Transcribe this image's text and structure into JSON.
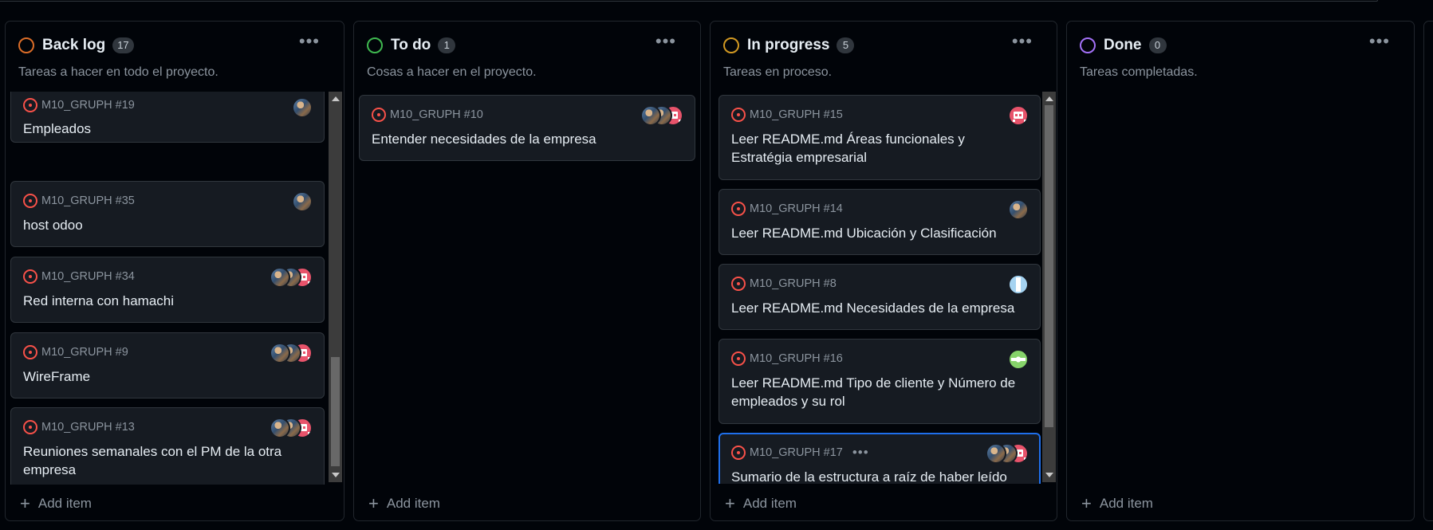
{
  "board": {
    "columns": [
      {
        "title": "Back log",
        "count": "17",
        "description": "Tareas a hacer en todo el proyecto.",
        "status_color": "#db6d28",
        "add_item": "Add item",
        "cards": [
          {
            "ref": "M10_GRUPH #19",
            "title": "Empleados",
            "avatars": [
              "photo"
            ]
          },
          {
            "ref": "M10_GRUPH #35",
            "title": "host odoo",
            "avatars": [
              "photo"
            ]
          },
          {
            "ref": "M10_GRUPH #34",
            "title": "Red interna con hamachi",
            "avatars": [
              "photo",
              "photo",
              "pink"
            ]
          },
          {
            "ref": "M10_GRUPH #9",
            "title": "WireFrame",
            "avatars": [
              "photo",
              "photo",
              "pink"
            ]
          },
          {
            "ref": "M10_GRUPH #13",
            "title": "Reuniones semanales con el PM de la otra empresa",
            "avatars": [
              "photo",
              "photo",
              "pink"
            ]
          }
        ]
      },
      {
        "title": "To do",
        "count": "1",
        "description": "Cosas a hacer en el proyecto.",
        "status_color": "#3fb950",
        "add_item": "Add item",
        "cards": [
          {
            "ref": "M10_GRUPH #10",
            "title": "Entender necesidades de la empresa",
            "avatars": [
              "photo",
              "photo",
              "pink"
            ]
          }
        ]
      },
      {
        "title": "In progress",
        "count": "5",
        "description": "Tareas en proceso.",
        "status_color": "#d29922",
        "add_item": "Add item",
        "cards": [
          {
            "ref": "M10_GRUPH #15",
            "title": "Leer README.md Áreas funcionales y Estratégia empresarial",
            "avatars": [
              "pink"
            ]
          },
          {
            "ref": "M10_GRUPH #14",
            "title": "Leer README.md Ubicación y Clasificación",
            "avatars": [
              "photo"
            ]
          },
          {
            "ref": "M10_GRUPH #8",
            "title": "Leer README.md Necesidades de la empresa",
            "avatars": [
              "blue"
            ]
          },
          {
            "ref": "M10_GRUPH #16",
            "title": "Leer README.md Tipo de cliente y Número de empleados y su rol",
            "avatars": [
              "green"
            ]
          },
          {
            "ref": "M10_GRUPH #17",
            "title": "Sumario de la estructura a raíz de haber leído",
            "avatars": [
              "photo",
              "photo",
              "pink"
            ],
            "selected": true,
            "menu": "•••"
          }
        ]
      },
      {
        "title": "Done",
        "count": "0",
        "description": "Tareas completadas.",
        "status_color": "#a371f7",
        "add_item": "Add item",
        "cards": []
      }
    ]
  }
}
